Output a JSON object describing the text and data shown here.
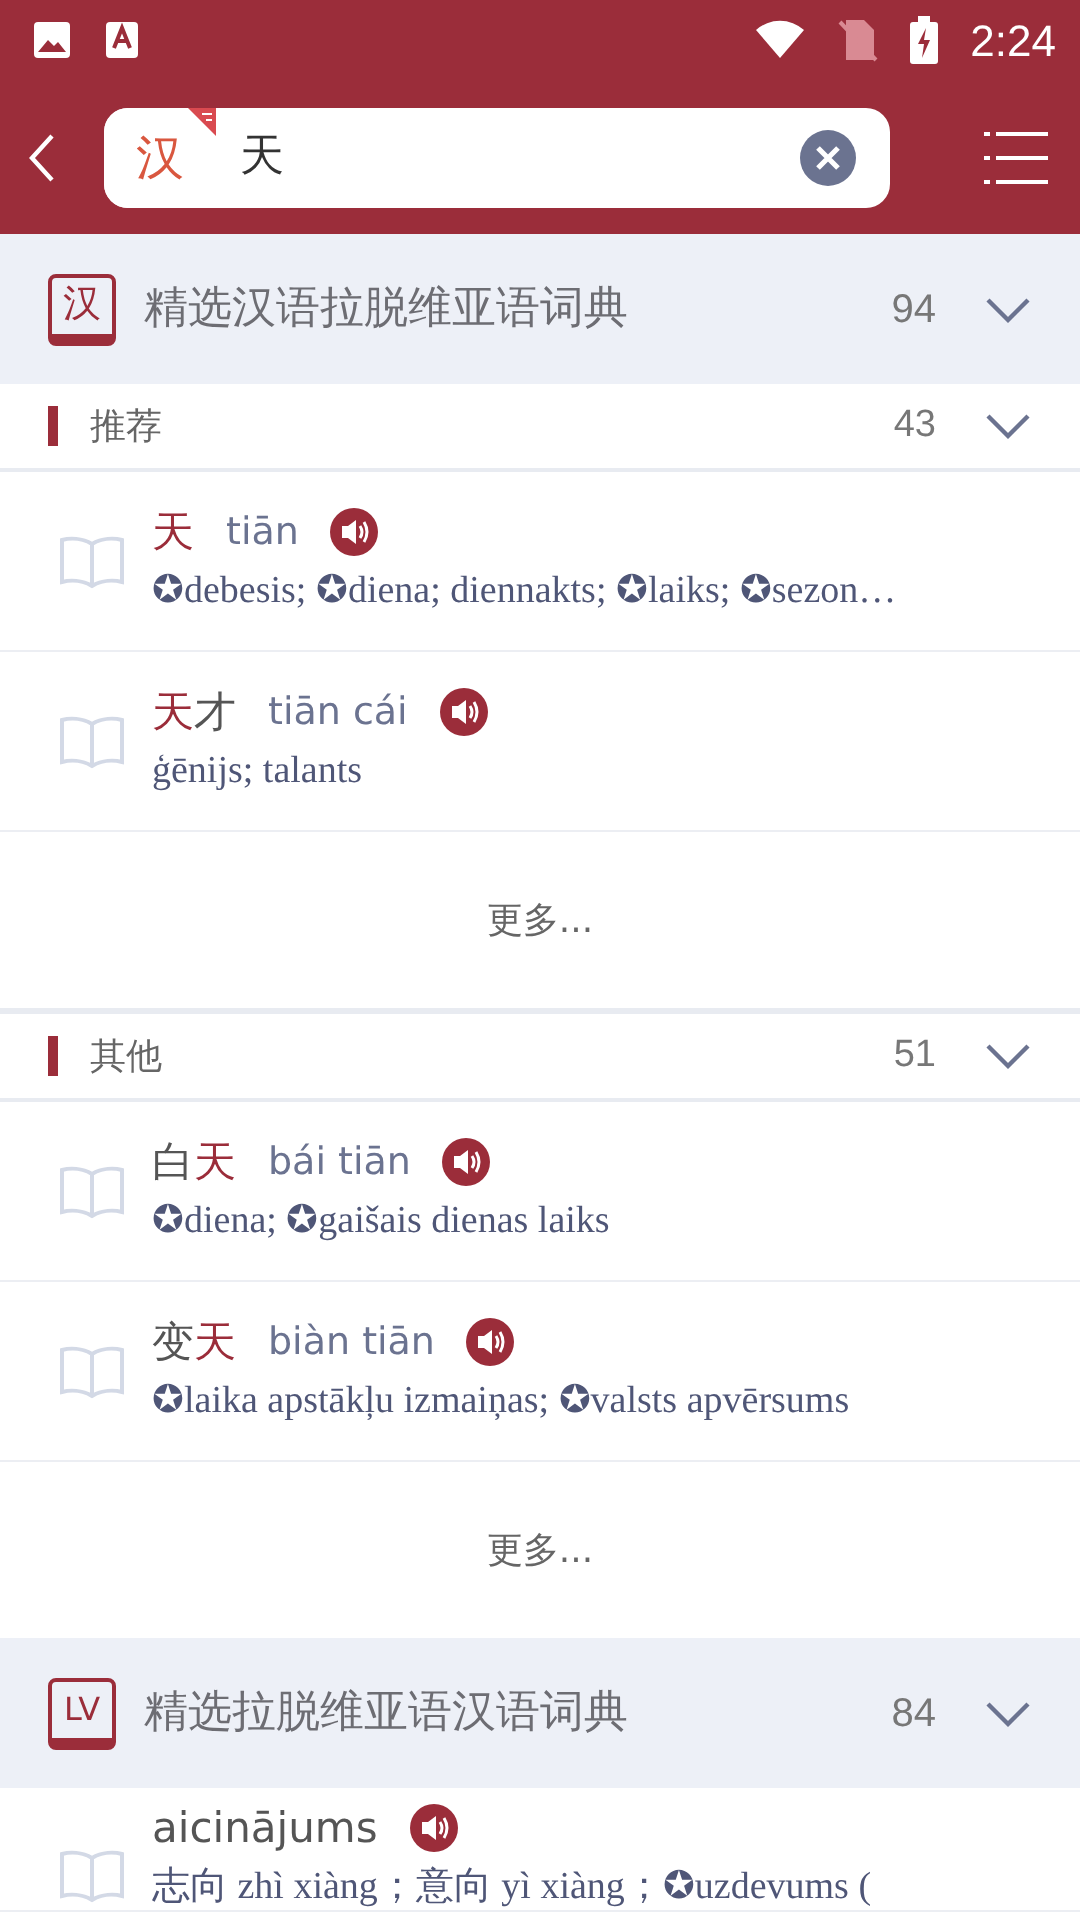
{
  "status_bar": {
    "time": "2:24"
  },
  "search": {
    "language": "汉",
    "value": "天"
  },
  "dictionaries": [
    {
      "badge": "汉",
      "title": "精选汉语拉脱维亚语词典",
      "count": "94",
      "groups": [
        {
          "title": "推荐",
          "count": "43",
          "entries": [
            {
              "headword": [
                {
                  "text": "天",
                  "match": true
                }
              ],
              "pinyin": "tiān",
              "definition": "✪debesis; ✪diena; diennakts; ✪laiks; ✪sezon…"
            },
            {
              "headword": [
                {
                  "text": "天",
                  "match": true
                },
                {
                  "text": "才",
                  "match": false
                }
              ],
              "pinyin": "tiān cái",
              "definition": "ģēnijs; talants"
            }
          ],
          "more": "更多..."
        },
        {
          "title": "其他",
          "count": "51",
          "entries": [
            {
              "headword": [
                {
                  "text": "白",
                  "match": false
                },
                {
                  "text": "天",
                  "match": true
                }
              ],
              "pinyin": "bái tiān",
              "definition": "✪diena; ✪gaišais dienas laiks"
            },
            {
              "headword": [
                {
                  "text": "变",
                  "match": false
                },
                {
                  "text": "天",
                  "match": true
                }
              ],
              "pinyin": "biàn tiān",
              "definition": "✪laika apstākļu izmaiņas; ✪valsts apvērsums"
            }
          ],
          "more": "更多..."
        }
      ]
    },
    {
      "badge": "LV",
      "title": "精选拉脱维亚语汉语词典",
      "count": "84",
      "entries": [
        {
          "headword": [
            {
              "text": "aicinājums",
              "match": false
            }
          ],
          "definition": "志向 zhì xiàng；意向 yì xiàng；✪uzdevums ("
        }
      ]
    }
  ]
}
